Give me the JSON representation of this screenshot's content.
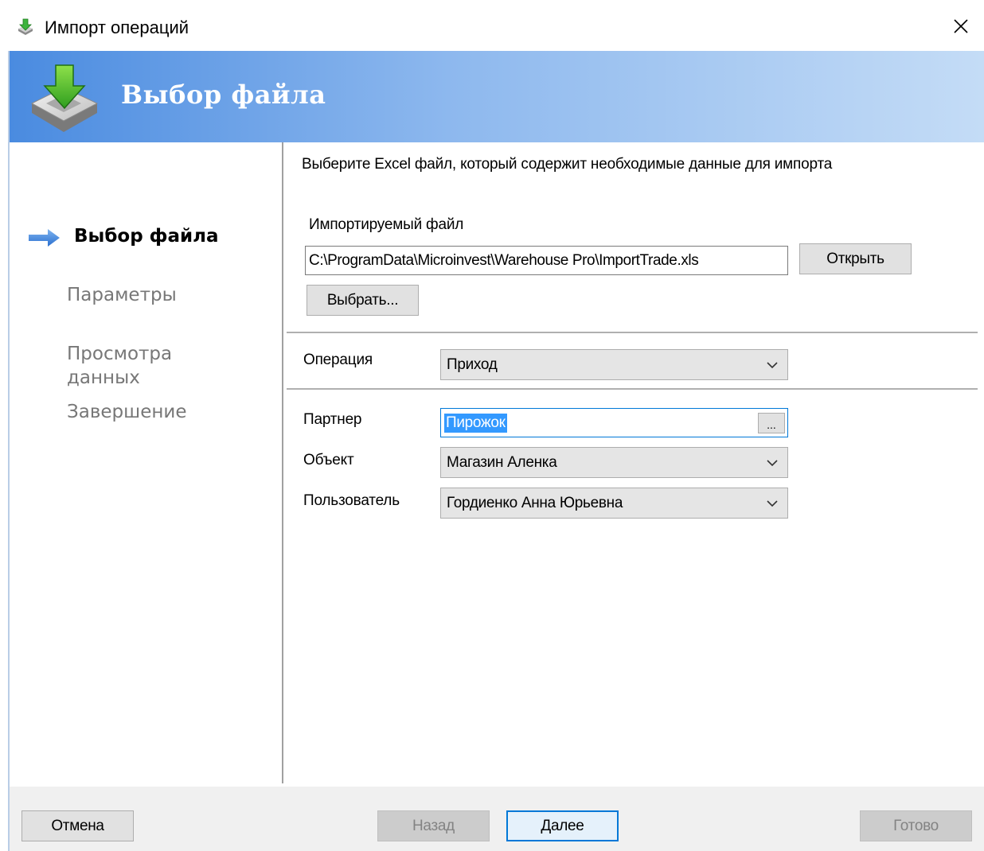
{
  "window": {
    "title": "Импорт операций",
    "close_glyph": "✕"
  },
  "banner": {
    "title": "Выбор файла"
  },
  "steps": [
    {
      "label": "Выбор файла",
      "active": true
    },
    {
      "label": "Параметры",
      "active": false
    },
    {
      "label": "Просмотра данных",
      "active": false
    },
    {
      "label": "Завершение",
      "active": false
    }
  ],
  "main": {
    "instructions": "Выберите Excel файл, который содержит необходимые данные для  импорта",
    "file_label": "Импортируемый файл",
    "file_path": "C:\\ProgramData\\Microinvest\\Warehouse Pro\\ImportTrade.xls",
    "open_button": "Открыть",
    "browse_button": "Выбрать...",
    "operation_label": "Операция",
    "operation_value": "Приход",
    "partner_label": "Партнер",
    "partner_value": "Пирожок",
    "partner_ellipsis": "...",
    "object_label": "Объект",
    "object_value": "Магазин Аленка",
    "user_label": "Пользователь",
    "user_value": "Гордиенко Анна Юрьевна"
  },
  "footer": {
    "cancel": "Отмена",
    "back": "Назад",
    "next": "Далее",
    "finish": "Готово"
  },
  "colors": {
    "accent": "#0078d7",
    "banner_start": "#4a8be0",
    "banner_end": "#c4dcf6",
    "selection": "#3399ff",
    "step_arrow": "#3a7fd5"
  }
}
